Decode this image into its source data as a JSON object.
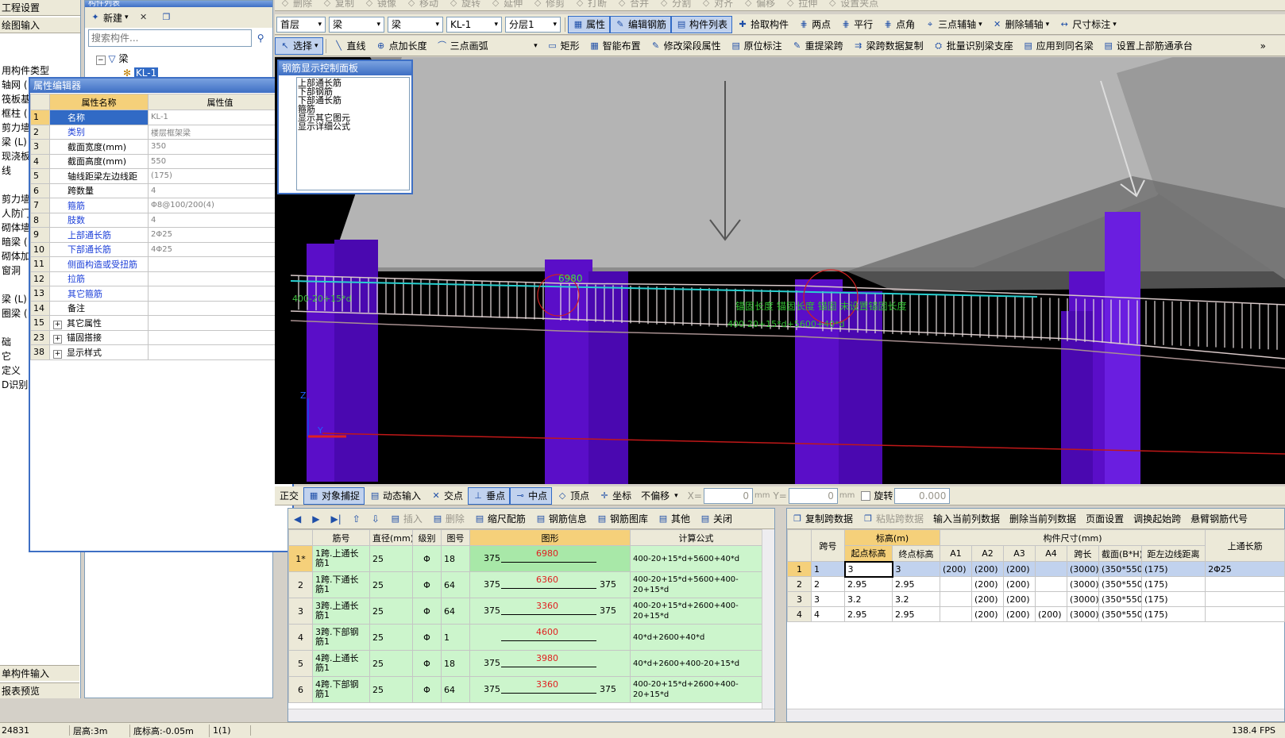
{
  "left_panel": {
    "title": "工程设置",
    "nav": "绘图输入",
    "tree": [
      "用构件类型",
      "轴网 (",
      "筏板基",
      "框柱 (",
      "剪力墙",
      "梁 (L)",
      "现浇板",
      "线",
      "",
      "剪力墙",
      "人防门",
      "砌体墙",
      "暗梁 (",
      "砌体加",
      "窗洞",
      "",
      "梁 (L)",
      "圈梁 (",
      "",
      "础",
      "它",
      "定义",
      "D识别"
    ],
    "bottom1": "单构件输入",
    "bottom2": "报表预览"
  },
  "component_list": {
    "title": "构件列表",
    "new_label": "新建",
    "search_placeholder": "搜索构件...",
    "tree_root": "梁",
    "tree_child": "KL-1"
  },
  "prop_editor": {
    "title": "属性编辑器",
    "col_name": "属性名称",
    "col_value": "属性值",
    "rows": [
      {
        "no": "1",
        "name": "名称",
        "value": "KL-1",
        "blue": true,
        "exp": ""
      },
      {
        "no": "2",
        "name": "类别",
        "value": "楼层框架梁",
        "blue": true,
        "exp": ""
      },
      {
        "no": "3",
        "name": "截面宽度(mm)",
        "value": "350",
        "blue": false,
        "exp": ""
      },
      {
        "no": "4",
        "name": "截面高度(mm)",
        "value": "550",
        "blue": false,
        "exp": ""
      },
      {
        "no": "5",
        "name": "轴线距梁左边线距",
        "value": "(175)",
        "blue": false,
        "exp": ""
      },
      {
        "no": "6",
        "name": "跨数量",
        "value": "4",
        "blue": false,
        "exp": ""
      },
      {
        "no": "7",
        "name": "箍筋",
        "value": "Φ8@100/200(4)",
        "blue": true,
        "exp": ""
      },
      {
        "no": "8",
        "name": "肢数",
        "value": "4",
        "blue": true,
        "exp": ""
      },
      {
        "no": "9",
        "name": "上部通长筋",
        "value": "2Φ25",
        "blue": true,
        "exp": ""
      },
      {
        "no": "10",
        "name": "下部通长筋",
        "value": "4Φ25",
        "blue": true,
        "exp": ""
      },
      {
        "no": "11",
        "name": "侧面构造或受扭筋",
        "value": "",
        "blue": true,
        "exp": ""
      },
      {
        "no": "12",
        "name": "拉筋",
        "value": "",
        "blue": true,
        "exp": ""
      },
      {
        "no": "13",
        "name": "其它箍筋",
        "value": "",
        "blue": true,
        "exp": ""
      },
      {
        "no": "14",
        "name": "备注",
        "value": "",
        "blue": false,
        "exp": ""
      },
      {
        "no": "15",
        "name": "其它属性",
        "value": "",
        "blue": false,
        "exp": "+"
      },
      {
        "no": "23",
        "name": "锚固搭接",
        "value": "",
        "blue": false,
        "exp": "+"
      },
      {
        "no": "38",
        "name": "显示样式",
        "value": "",
        "blue": false,
        "exp": "+"
      }
    ]
  },
  "toolbar1": [
    "删除",
    "复制",
    "镜像",
    "移动",
    "旋转",
    "延伸",
    "修剪",
    "打断",
    "合并",
    "分割",
    "对齐",
    "偏移",
    "拉伸",
    "设置夹点"
  ],
  "toolbar2": {
    "floor": "首层",
    "type1": "梁",
    "type2": "梁",
    "comp": "KL-1",
    "layer": "分层1",
    "items": [
      "属性",
      "编辑钢筋",
      "构件列表",
      "拾取构件",
      "两点",
      "平行",
      "点角",
      "三点辅轴",
      "删除辅轴",
      "尺寸标注"
    ]
  },
  "toolbar3": {
    "select": "选择",
    "items": [
      "直线",
      "点加长度",
      "三点画弧",
      "矩形",
      "智能布置",
      "修改梁段属性",
      "原位标注",
      "重提梁跨",
      "梁跨数据复制",
      "批量识别梁支座",
      "应用到同名梁",
      "设置上部筋通承台"
    ]
  },
  "rebar_panel": {
    "title": "钢筋显示控制面板",
    "items": [
      "上部通长筋",
      "下部钢筋",
      "下部通长筋",
      "箍筋",
      "显示其它图元",
      "显示详细公式"
    ]
  },
  "viewport": {
    "label_6980": "6980",
    "label_left": "400-20+15*d",
    "label_mid": "400-20+15*d+5600+40*d",
    "label_green": "锚固长度 锚固长度 锚固 未设置锚固长度",
    "axis_z": "Z",
    "axis_y": "Y"
  },
  "snap_bar": {
    "items": [
      "正交",
      "对象捕捉",
      "动态输入",
      "交点",
      "垂点",
      "中点",
      "顶点",
      "坐标",
      "不偏移"
    ],
    "x_label": "X=",
    "x_val": "0",
    "y_label": "Y=",
    "y_val": "0",
    "unit": "mm",
    "rotate": "旋转",
    "rotate_val": "0.000"
  },
  "rebar_table": {
    "toolbar": [
      "插入",
      "删除",
      "缩尺配筋",
      "钢筋信息",
      "钢筋图库",
      "其他",
      "关闭"
    ],
    "headers": [
      "筋号",
      "直径(mm)",
      "级别",
      "图号",
      "图形",
      "计算公式"
    ],
    "rows": [
      {
        "idx": "1*",
        "name": "1跨.上通长筋1",
        "dia": "25",
        "grade": "Φ",
        "fig": "18",
        "left": "375",
        "len": "6980",
        "right": "",
        "formula": "400-20+15*d+5600+40*d"
      },
      {
        "idx": "2",
        "name": "1跨.下通长筋1",
        "dia": "25",
        "grade": "Φ",
        "fig": "64",
        "left": "375",
        "len": "6360",
        "right": "375",
        "formula": "400-20+15*d+5600+400-20+15*d"
      },
      {
        "idx": "3",
        "name": "3跨.上通长筋1",
        "dia": "25",
        "grade": "Φ",
        "fig": "64",
        "left": "375",
        "len": "3360",
        "right": "375",
        "formula": "400-20+15*d+2600+400-20+15*d"
      },
      {
        "idx": "4",
        "name": "3跨.下部钢筋1",
        "dia": "25",
        "grade": "Φ",
        "fig": "1",
        "left": "",
        "len": "4600",
        "right": "",
        "formula": "40*d+2600+40*d"
      },
      {
        "idx": "5",
        "name": "4跨.上通长筋1",
        "dia": "25",
        "grade": "Φ",
        "fig": "18",
        "left": "375",
        "len": "3980",
        "right": "",
        "formula": "40*d+2600+400-20+15*d"
      },
      {
        "idx": "6",
        "name": "4跨.下部钢筋1",
        "dia": "25",
        "grade": "Φ",
        "fig": "64",
        "left": "375",
        "len": "3360",
        "right": "375",
        "formula": "400-20+15*d+2600+400-20+15*d"
      }
    ]
  },
  "span_table": {
    "toolbar": [
      "复制跨数据",
      "粘贴跨数据",
      "输入当前列数据",
      "删除当前列数据",
      "页面设置",
      "调换起始跨",
      "悬臂钢筋代号"
    ],
    "h_span": "跨号",
    "h_elev": "标高(m)",
    "h_start": "起点标高",
    "h_end": "终点标高",
    "h_dims": "构件尺寸(mm)",
    "h_cols": [
      "A1",
      "A2",
      "A3",
      "A4",
      "跨长",
      "截面(B*H)",
      "距左边线距离"
    ],
    "h_top": "上通长筋",
    "rows": [
      {
        "no": "1",
        "span": "1",
        "start": "3",
        "end": "3",
        "a1": "(200)",
        "a2": "(200)",
        "a3": "(200)",
        "a4": "",
        "len": "(3000)",
        "sec": "(350*550)",
        "dist": "(175)",
        "top": "2Φ25"
      },
      {
        "no": "2",
        "span": "2",
        "start": "2.95",
        "end": "2.95",
        "a1": "",
        "a2": "(200)",
        "a3": "(200)",
        "a4": "",
        "len": "(3000)",
        "sec": "(350*550)",
        "dist": "(175)",
        "top": ""
      },
      {
        "no": "3",
        "span": "3",
        "start": "3.2",
        "end": "3.2",
        "a1": "",
        "a2": "(200)",
        "a3": "(200)",
        "a4": "",
        "len": "(3000)",
        "sec": "(350*550)",
        "dist": "(175)",
        "top": ""
      },
      {
        "no": "4",
        "span": "4",
        "start": "2.95",
        "end": "2.95",
        "a1": "",
        "a2": "(200)",
        "a3": "(200)",
        "a4": "(200)",
        "len": "(3000)",
        "sec": "(350*550)",
        "dist": "(175)",
        "top": ""
      }
    ]
  },
  "status": {
    "coord": "24831",
    "floor_h": "层高:3m",
    "base": "底标高:-0.05m",
    "sel": "1(1)",
    "fps": "138.4 FPS"
  }
}
